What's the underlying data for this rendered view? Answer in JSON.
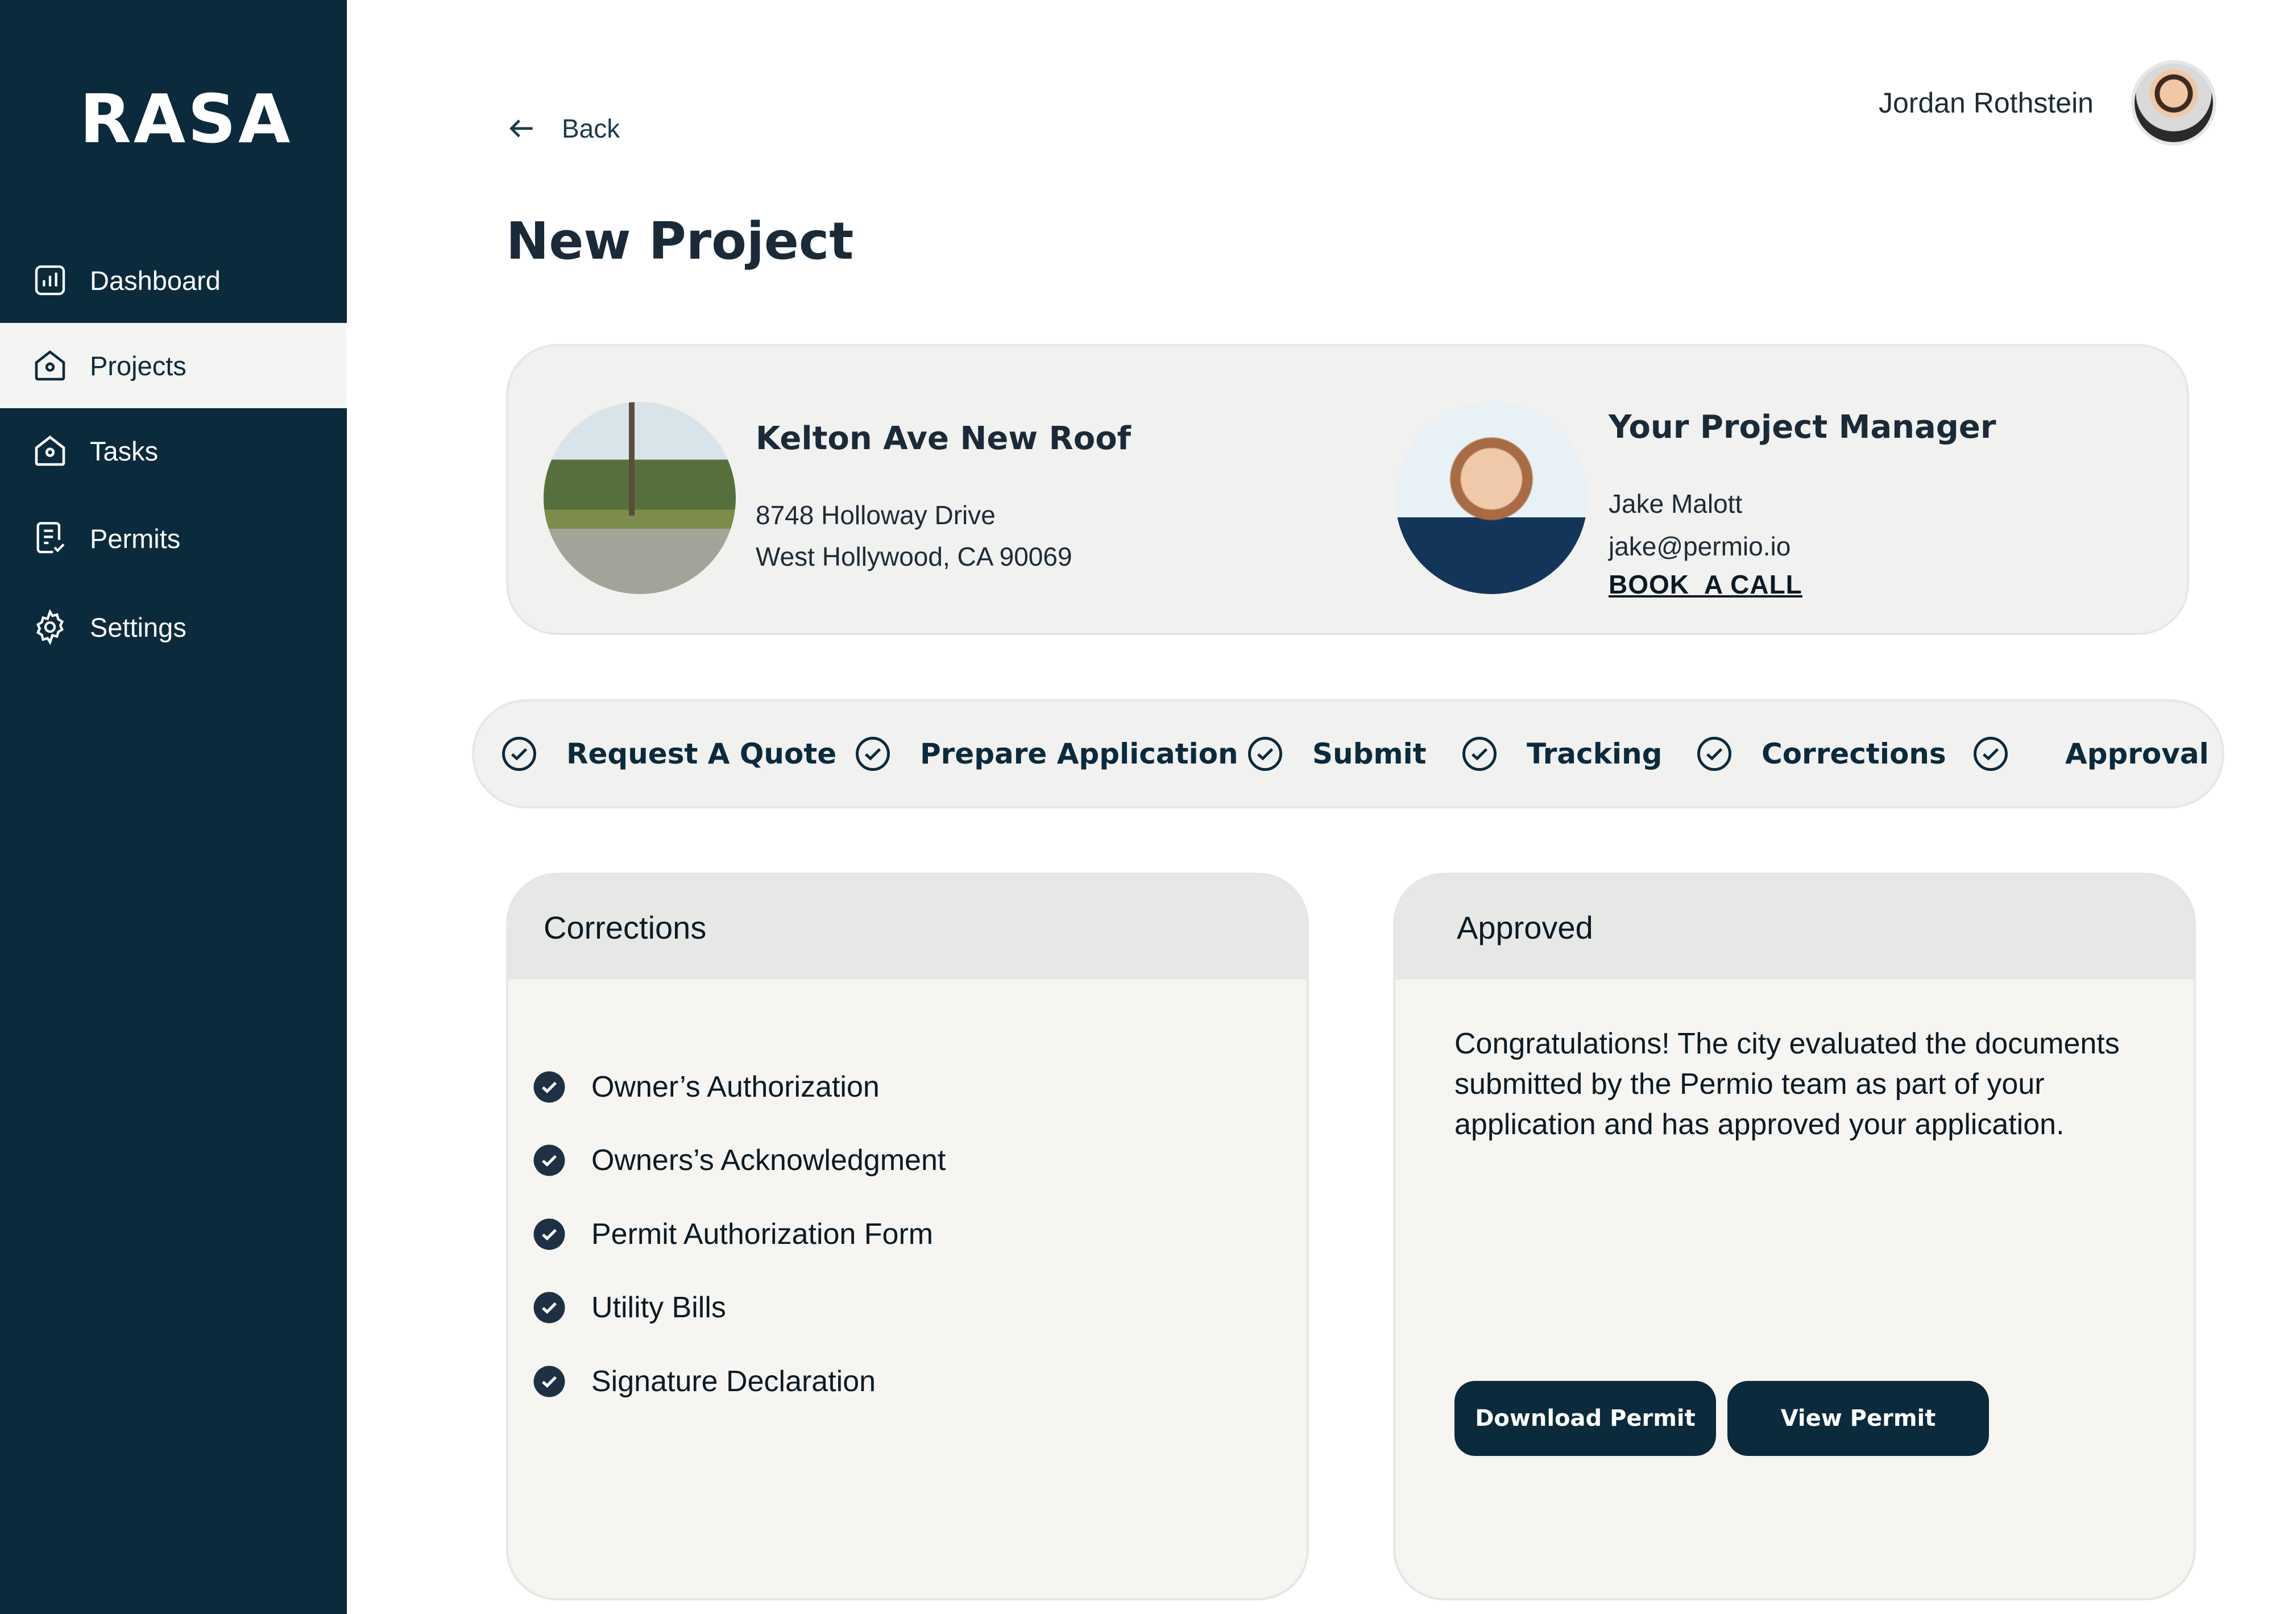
{
  "app": {
    "logo": "RASA"
  },
  "sidebar": {
    "items": [
      {
        "label": "Dashboard",
        "icon": "chart-icon"
      },
      {
        "label": "Projects",
        "icon": "home-icon",
        "active": true
      },
      {
        "label": "Tasks",
        "icon": "home-icon"
      },
      {
        "label": "Permits",
        "icon": "document-check-icon"
      },
      {
        "label": "Settings",
        "icon": "gear-icon"
      }
    ]
  },
  "header": {
    "back_label": "Back",
    "user_name": "Jordan Rothstein",
    "page_title": "New Project"
  },
  "project": {
    "name": "Kelton Ave New Roof",
    "address_line1": "8748 Holloway Drive",
    "address_line2": "West Hollywood, CA 90069"
  },
  "manager": {
    "title": "Your Project Manager",
    "name": "Jake Malott",
    "email": "jake@permio.io",
    "book_label": "BOOK  A CALL"
  },
  "steps": [
    {
      "label": "Request A Quote",
      "done": true
    },
    {
      "label": "Prepare Application",
      "done": true
    },
    {
      "label": "Submit",
      "done": true
    },
    {
      "label": "Tracking",
      "done": true
    },
    {
      "label": "Corrections",
      "done": true
    },
    {
      "label": "Approval",
      "done": true
    }
  ],
  "corrections": {
    "title": "Corrections",
    "items": [
      "Owner’s Authorization",
      "Owners’s Acknowledgment",
      "Permit Authorization Form",
      "Utility Bills",
      "Signature Declaration"
    ]
  },
  "approved": {
    "title": "Approved",
    "message": "Congratulations! The city evaluated the documents submitted by the Permio team as part of your application and has approved your application.",
    "download_label": "Download Permit",
    "view_label": "View Permit"
  },
  "colors": {
    "navy": "#0b2a3c",
    "card_bg": "#f1f1f0",
    "active_nav": "#f4f4f2"
  }
}
